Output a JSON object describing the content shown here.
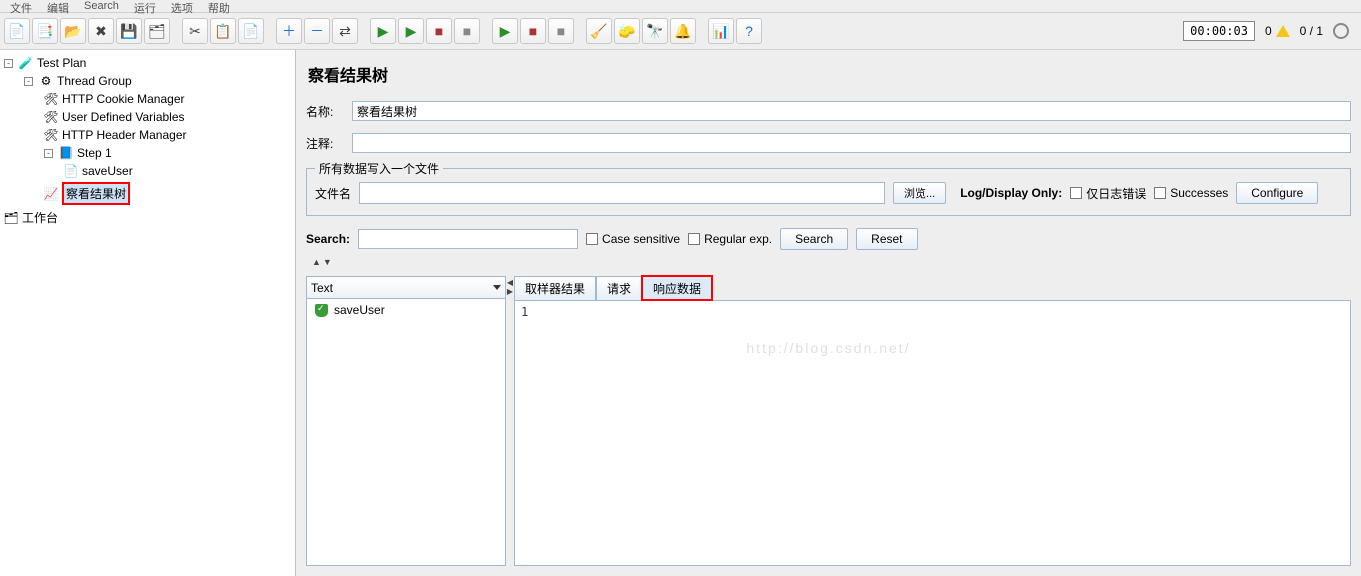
{
  "menubar": [
    "文件",
    "编辑",
    "Search",
    "运行",
    "选项",
    "帮助"
  ],
  "toolbar": {
    "timer": "00:00:03",
    "count_left": "0",
    "count_right": "0 / 1"
  },
  "tree": {
    "root": "Test Plan",
    "thread_group": "Thread Group",
    "cookie_mgr": "HTTP Cookie Manager",
    "udv": "User Defined Variables",
    "header_mgr": "HTTP Header Manager",
    "step1": "Step 1",
    "save_user": "saveUser",
    "view_results": "察看结果树",
    "workbench": "工作台"
  },
  "panel": {
    "title": "察看结果树",
    "name_label": "名称:",
    "name_value": "察看结果树",
    "comment_label": "注释:",
    "comment_value": "",
    "file_group_legend": "所有数据写入一个文件",
    "filename_label": "文件名",
    "browse_btn": "浏览...",
    "log_display_label": "Log/Display Only:",
    "log_errors": "仅日志错误",
    "successes": "Successes",
    "configure_btn": "Configure",
    "search_label": "Search:",
    "case_sensitive": "Case sensitive",
    "regex": "Regular exp.",
    "search_btn": "Search",
    "reset_btn": "Reset",
    "combo_text": "Text",
    "tabs": {
      "sampler": "取样器结果",
      "request": "请求",
      "response": "响应数据"
    },
    "result_item": "saveUser",
    "response_body": "1"
  },
  "watermark": "http://blog.csdn.net/"
}
